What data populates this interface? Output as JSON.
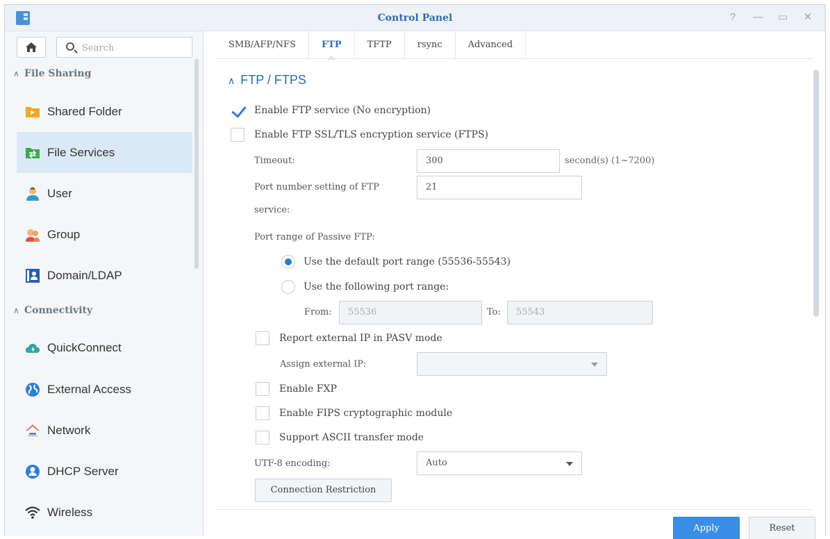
{
  "window": {
    "title": "Control Panel",
    "controls": [
      "?",
      "—",
      "▭",
      "✕"
    ]
  },
  "sidebar": {
    "search_placeholder": "Search",
    "sections": [
      {
        "label": "File Sharing",
        "items": [
          {
            "label": "Shared Folder",
            "icon": "folder-share-icon",
            "active": false
          },
          {
            "label": "File Services",
            "icon": "file-services-icon",
            "active": true
          },
          {
            "label": "User",
            "icon": "user-icon",
            "active": false
          },
          {
            "label": "Group",
            "icon": "group-icon",
            "active": false
          },
          {
            "label": "Domain/LDAP",
            "icon": "domain-icon",
            "active": false
          }
        ]
      },
      {
        "label": "Connectivity",
        "items": [
          {
            "label": "QuickConnect",
            "icon": "cloud-icon",
            "active": false
          },
          {
            "label": "External Access",
            "icon": "globe-icon",
            "active": false
          },
          {
            "label": "Network",
            "icon": "house-network-icon",
            "active": false
          },
          {
            "label": "DHCP Server",
            "icon": "dhcp-icon",
            "active": false
          },
          {
            "label": "Wireless",
            "icon": "wifi-icon",
            "active": false
          }
        ]
      }
    ]
  },
  "tabs": [
    {
      "label": "SMB/AFP/NFS",
      "active": false
    },
    {
      "label": "FTP",
      "active": true
    },
    {
      "label": "TFTP",
      "active": false
    },
    {
      "label": "rsync",
      "active": false
    },
    {
      "label": "Advanced",
      "active": false
    }
  ],
  "panel": {
    "title": "FTP / FTPS",
    "enable_ftp": {
      "label": "Enable FTP service (No encryption)",
      "checked": true
    },
    "enable_ftps": {
      "label": "Enable FTP SSL/TLS encryption service (FTPS)",
      "checked": false
    },
    "timeout": {
      "label": "Timeout:",
      "value": "300",
      "hint": "second(s) (1~7200)"
    },
    "port": {
      "label_line1": "Port number setting of FTP",
      "label_line2": "service:",
      "value": "21"
    },
    "passive": {
      "label": "Port range of Passive FTP:",
      "default_option": {
        "label": "Use the default port range (55536-55543)",
        "selected": true
      },
      "custom_option": {
        "label": "Use the following port range:",
        "selected": false
      },
      "from_label": "From:",
      "from_value": "55536",
      "to_label": "To:",
      "to_value": "55543"
    },
    "report_ip": {
      "label": "Report external IP in PASV mode",
      "checked": false
    },
    "assign_ip": {
      "label": "Assign external IP:",
      "value": ""
    },
    "enable_fxp": {
      "label": "Enable FXP",
      "checked": false
    },
    "enable_fips": {
      "label": "Enable FIPS cryptographic module",
      "checked": false
    },
    "ascii_mode": {
      "label": "Support ASCII transfer mode",
      "checked": false
    },
    "utf8": {
      "label": "UTF-8 encoding:",
      "value": "Auto"
    },
    "connection_restriction_label": "Connection Restriction"
  },
  "footer": {
    "apply_label": "Apply",
    "reset_label": "Reset"
  },
  "colors": {
    "accent": "#2d6cb3",
    "primary_button": "#3a8ee6",
    "active_nav": "#dbe9f6"
  }
}
